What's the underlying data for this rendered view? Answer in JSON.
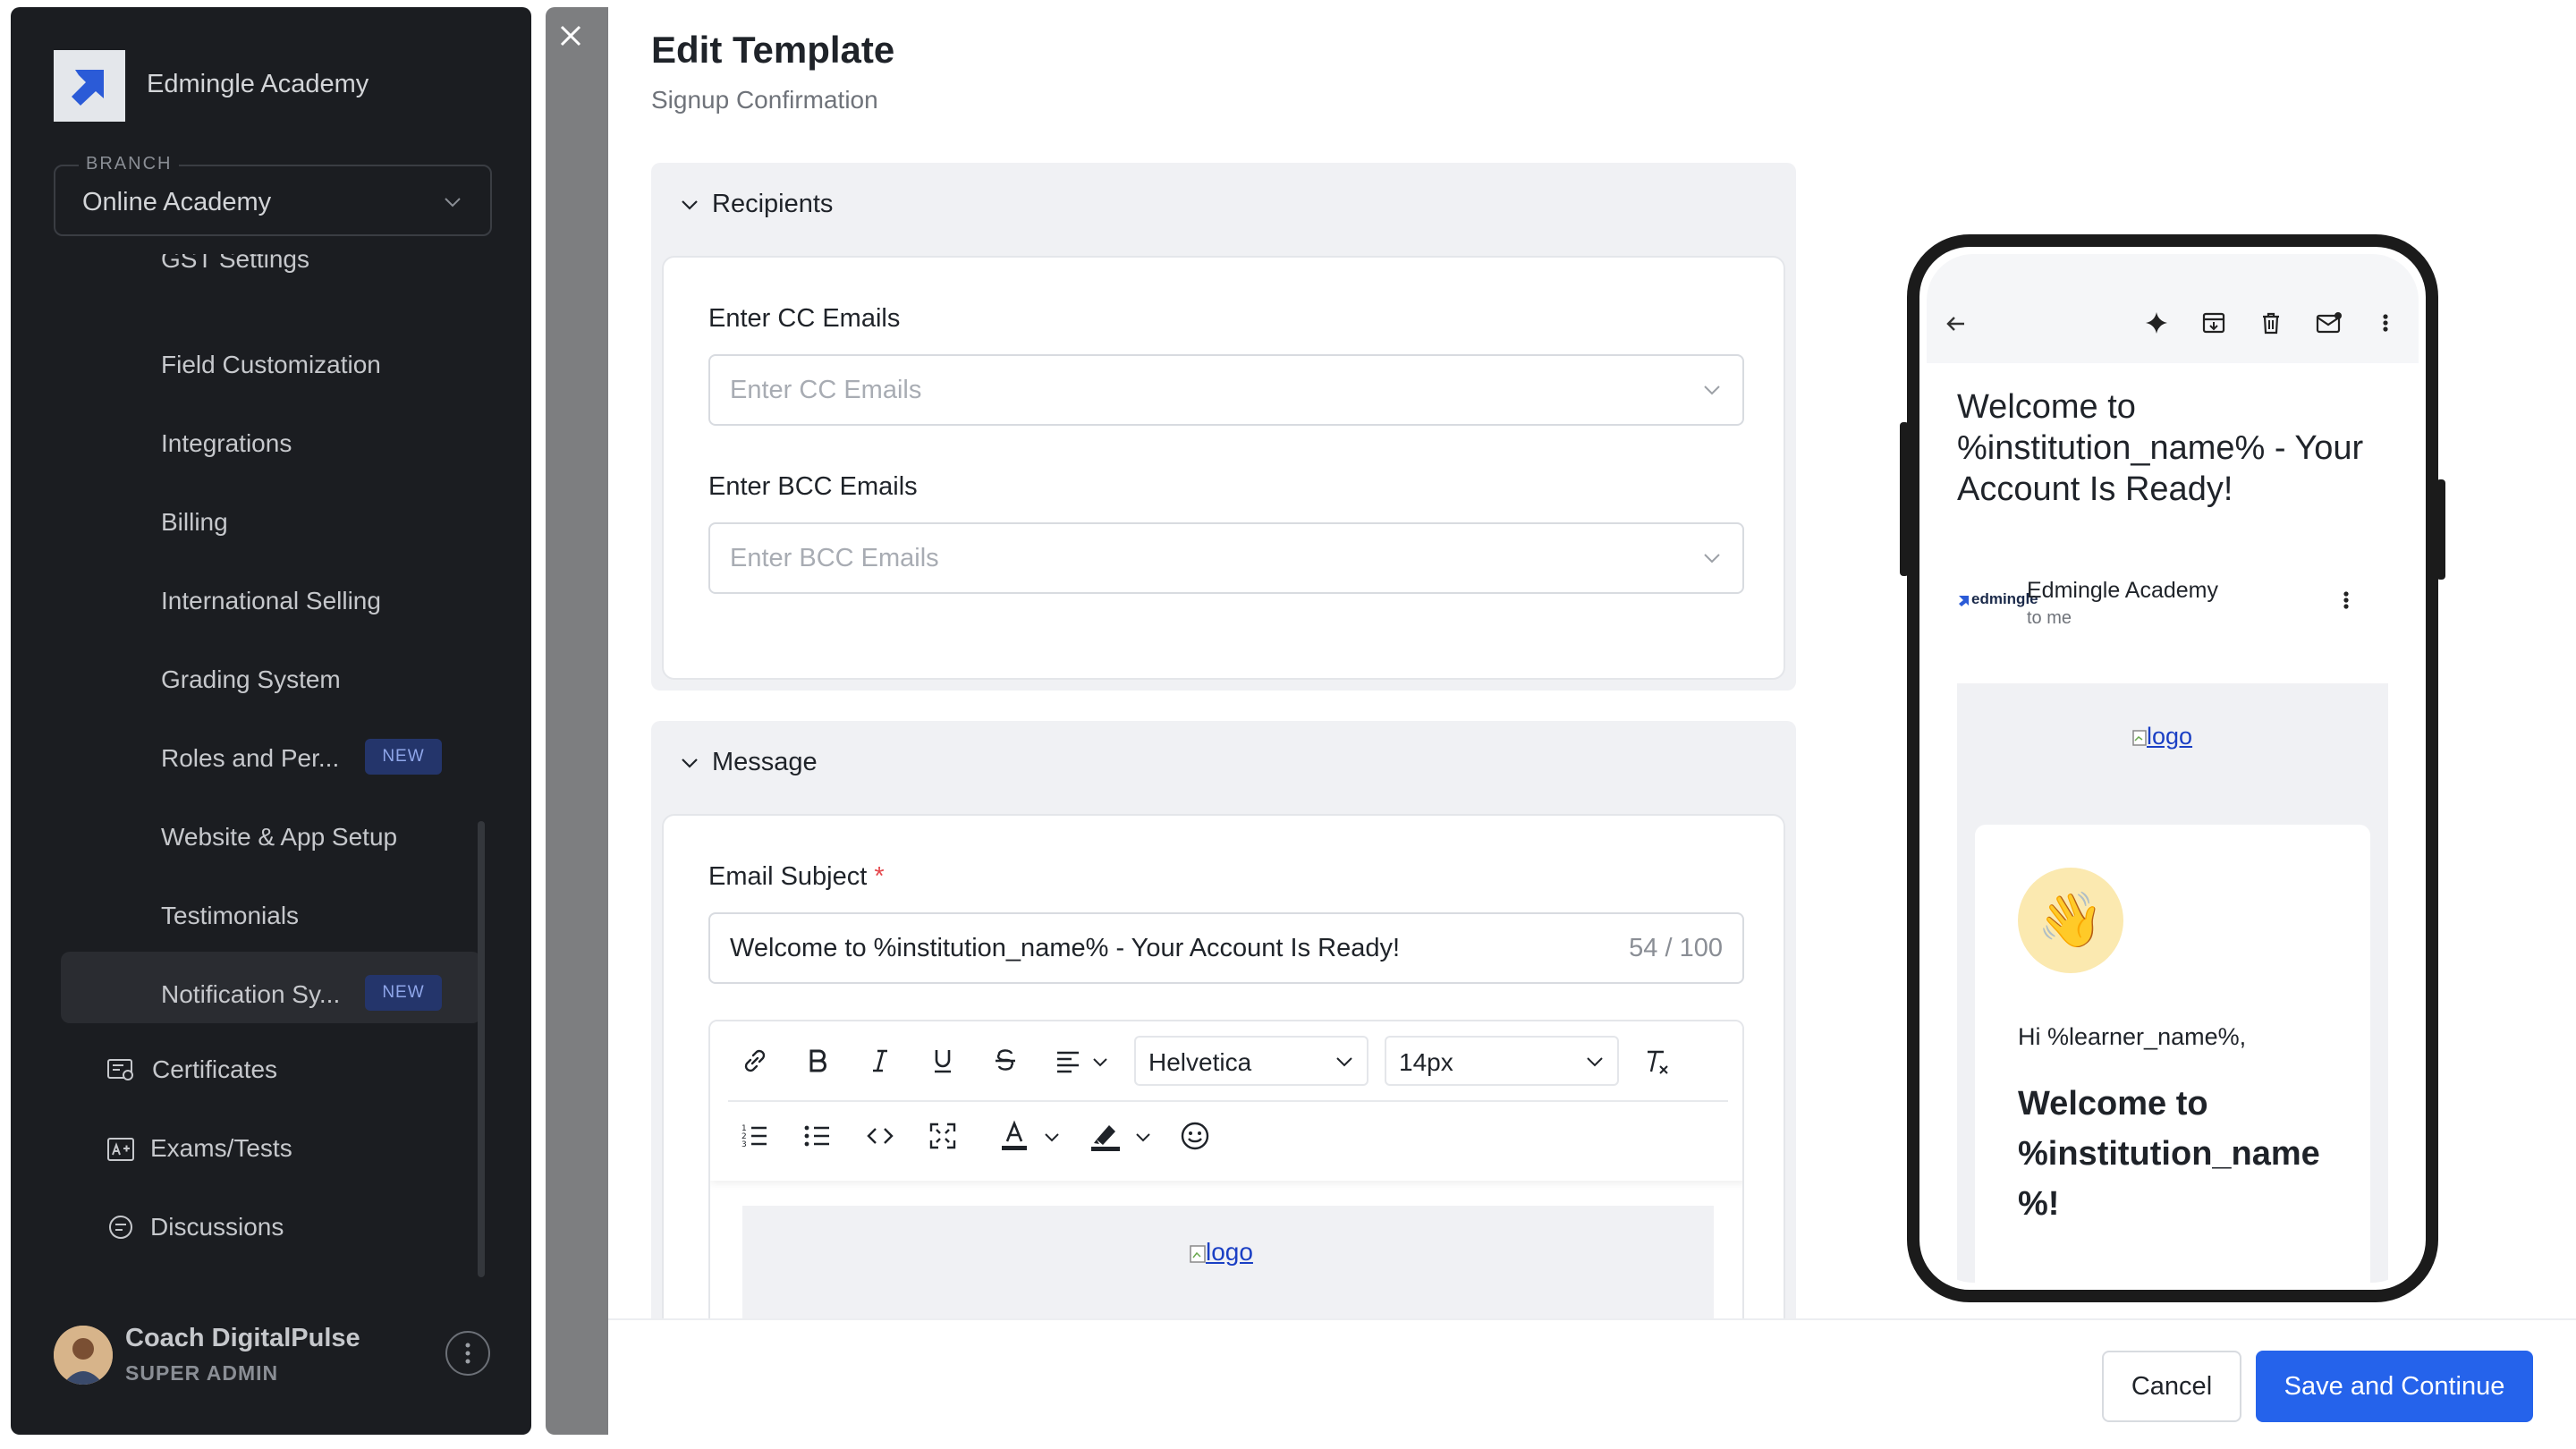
{
  "sidebar": {
    "brand": "Edmingle Academy",
    "branch_label": "BRANCH",
    "branch_value": "Online Academy",
    "items": [
      {
        "label": "GST Settings"
      },
      {
        "label": "Field Customization"
      },
      {
        "label": "Integrations"
      },
      {
        "label": "Billing"
      },
      {
        "label": "International Selling"
      },
      {
        "label": "Grading System"
      },
      {
        "label": "Roles and Per...",
        "badge": "NEW"
      },
      {
        "label": "Website & App Setup"
      },
      {
        "label": "Testimonials"
      },
      {
        "label": "Notification Sy...",
        "badge": "NEW",
        "active": true
      }
    ],
    "sections": [
      {
        "label": "Certificates",
        "icon": "certificate-icon"
      },
      {
        "label": "Exams/Tests",
        "icon": "exam-icon"
      },
      {
        "label": "Discussions",
        "icon": "discussion-icon"
      }
    ],
    "user": {
      "name": "Coach DigitalPulse",
      "role": "SUPER ADMIN"
    }
  },
  "modal": {
    "title": "Edit Template",
    "subtitle": "Signup Confirmation",
    "recipients": {
      "heading": "Recipients",
      "cc_label": "Enter CC Emails",
      "cc_placeholder": "Enter CC Emails",
      "bcc_label": "Enter BCC Emails",
      "bcc_placeholder": "Enter BCC Emails"
    },
    "message": {
      "heading": "Message",
      "subject_label": "Email Subject",
      "required_mark": "*",
      "subject_value": "Welcome to %institution_name% - Your Account Is Ready!",
      "subject_count": "54 / 100",
      "toolbar": {
        "font": "Helvetica",
        "size": "14px"
      },
      "body_logo_alt": "logo"
    }
  },
  "preview": {
    "email_title": "Welcome to %institution_name% - Your Account Is Ready!",
    "sender_logo": "edmingle",
    "sender_name": "Edmingle Academy",
    "sender_to": "to me",
    "logo_alt": "logo",
    "greeting": "Hi %learner_name%,",
    "welcome": "Welcome to %institution_name %!",
    "wave_emoji": "👋"
  },
  "footer": {
    "cancel_label": "Cancel",
    "save_label": "Save and Continue"
  },
  "colors": {
    "primary": "#2563eb",
    "sidebar_bg": "#1b1d21",
    "badge_bg": "#24356b",
    "required": "#e5484d"
  }
}
